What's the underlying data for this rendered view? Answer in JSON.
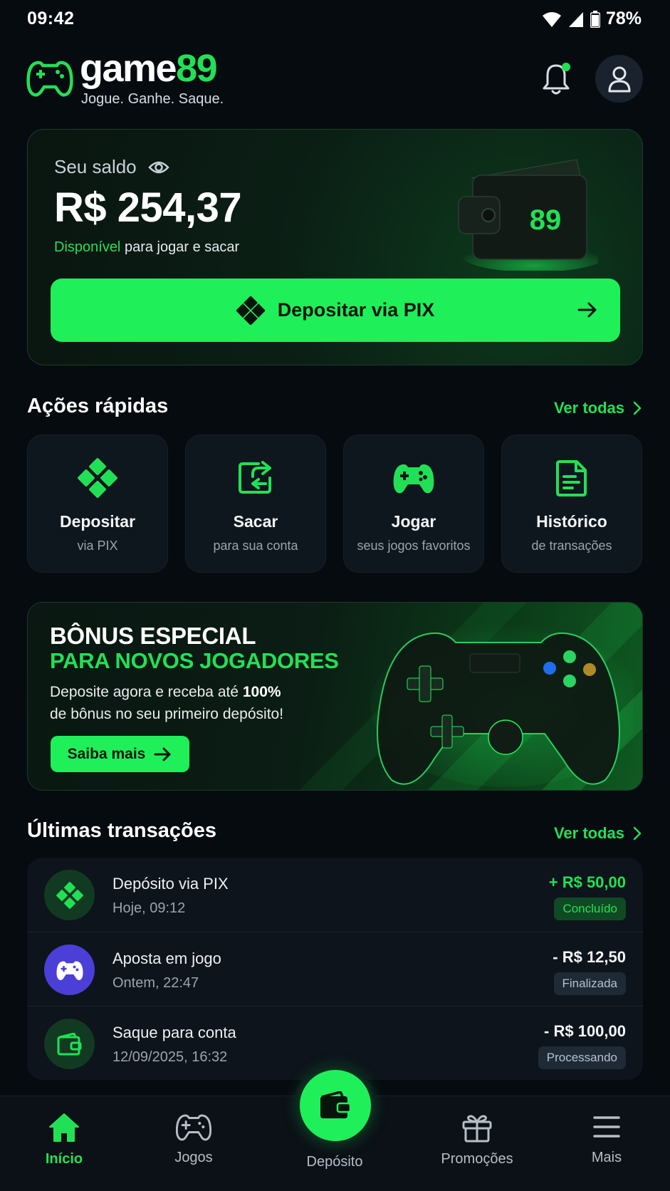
{
  "status_bar": {
    "time": "09:42",
    "battery": "78%"
  },
  "header": {
    "brand_word": "game",
    "brand_number": "89",
    "tagline": "Jogue. Ganhe. Saque."
  },
  "balance": {
    "label": "Seu saldo",
    "value": "R$ 254,37",
    "sub_highlight": "Disponível",
    "sub_rest": " para jogar e sacar",
    "wallet_badge": "89",
    "deposit_button": "Depositar via PIX"
  },
  "quick_actions": {
    "title": "Ações rápidas",
    "see_all": "Ver todas",
    "items": [
      {
        "title": "Depositar",
        "subtitle": "via PIX",
        "icon": "pix-icon"
      },
      {
        "title": "Sacar",
        "subtitle": "para sua conta",
        "icon": "withdraw-icon"
      },
      {
        "title": "Jogar",
        "subtitle": "seus jogos favoritos",
        "icon": "gamepad-icon"
      },
      {
        "title": "Histórico",
        "subtitle": "de transações",
        "icon": "document-icon"
      }
    ]
  },
  "bonus": {
    "title_line1": "BÔNUS ESPECIAL",
    "title_line2": "PARA NOVOS JOGADORES",
    "desc_part1": "Deposite agora e receba até ",
    "desc_bold": "100%",
    "desc_part2": "de bônus no seu primeiro depósito!",
    "button": "Saiba mais"
  },
  "transactions": {
    "title": "Últimas transações",
    "see_all": "Ver todas",
    "items": [
      {
        "title": "Depósito via PIX",
        "date": "Hoje, 09:12",
        "amount": "+ R$ 50,00",
        "status": "Concluído",
        "icon": "pix-icon"
      },
      {
        "title": "Aposta em jogo",
        "date": "Ontem, 22:47",
        "amount": "- R$ 12,50",
        "status": "Finalizada",
        "icon": "gamepad-icon"
      },
      {
        "title": "Saque para conta",
        "date": "12/09/2025, 16:32",
        "amount": "- R$ 100,00",
        "status": "Processando",
        "icon": "wallet-icon"
      }
    ]
  },
  "bottom_nav": {
    "items": [
      {
        "label": "Início",
        "icon": "home-icon",
        "active": true
      },
      {
        "label": "Jogos",
        "icon": "gamepad-icon",
        "active": false
      },
      {
        "label": "Depósito",
        "icon": "wallet-icon",
        "active": false
      },
      {
        "label": "Promoções",
        "icon": "gift-icon",
        "active": false
      },
      {
        "label": "Mais",
        "icon": "menu-icon",
        "active": false
      }
    ]
  },
  "colors": {
    "accent": "#1ff05a",
    "accent_text": "#22e055",
    "background": "#060b10",
    "card": "#0e161e",
    "game_purple": "#4b3fd8"
  }
}
